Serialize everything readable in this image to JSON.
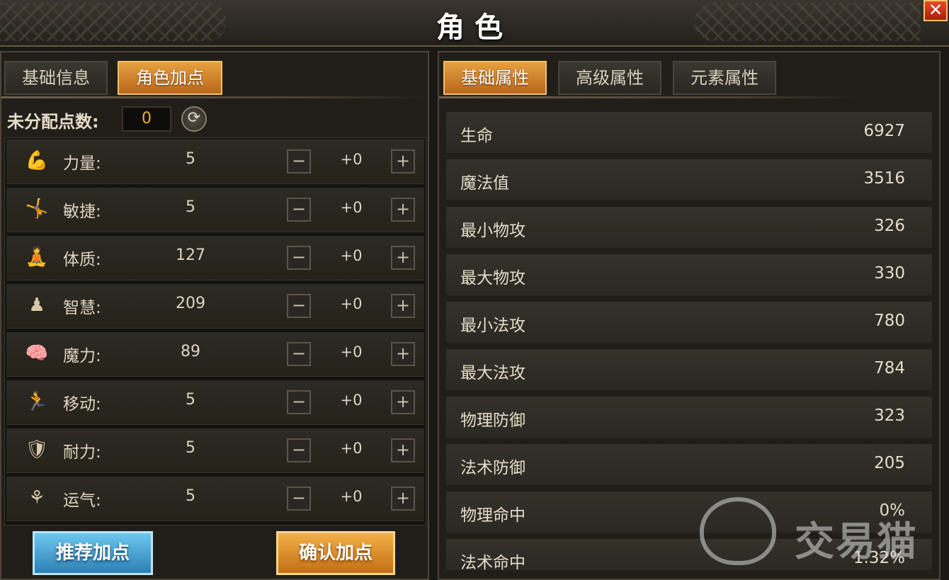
{
  "window": {
    "title": "角色",
    "close_label": "✕"
  },
  "left": {
    "tabs": [
      {
        "label": "基础信息",
        "active": false
      },
      {
        "label": "角色加点",
        "active": true
      }
    ],
    "unallocated": {
      "label": "未分配点数:",
      "value": "0"
    },
    "stats": [
      {
        "icon": "strength-arm-icon",
        "name": "力量:",
        "value": "5",
        "added": "+0"
      },
      {
        "icon": "agility-figure-icon",
        "name": "敏捷:",
        "value": "5",
        "added": "+0"
      },
      {
        "icon": "constitution-body-icon",
        "name": "体质:",
        "value": "127",
        "added": "+0"
      },
      {
        "icon": "wisdom-figure-icon",
        "name": "智慧:",
        "value": "209",
        "added": "+0"
      },
      {
        "icon": "magic-brain-icon",
        "name": "魔力:",
        "value": "89",
        "added": "+0"
      },
      {
        "icon": "movement-runner-icon",
        "name": "移动:",
        "value": "5",
        "added": "+0"
      },
      {
        "icon": "endurance-shield-icon",
        "name": "耐力:",
        "value": "5",
        "added": "+0"
      },
      {
        "icon": "luck-flower-icon",
        "name": "运气:",
        "value": "5",
        "added": "+0"
      }
    ],
    "minus_label": "−",
    "plus_label": "+",
    "recommend_button": "推荐加点",
    "confirm_button": "确认加点"
  },
  "right": {
    "tabs": [
      {
        "label": "基础属性",
        "active": true
      },
      {
        "label": "高级属性",
        "active": false
      },
      {
        "label": "元素属性",
        "active": false
      }
    ],
    "attributes": [
      {
        "name": "生命",
        "value": "6927"
      },
      {
        "name": "魔法值",
        "value": "3516"
      },
      {
        "name": "最小物攻",
        "value": "326"
      },
      {
        "name": "最大物攻",
        "value": "330"
      },
      {
        "name": "最小法攻",
        "value": "780"
      },
      {
        "name": "最大法攻",
        "value": "784"
      },
      {
        "name": "物理防御",
        "value": "323"
      },
      {
        "name": "法术防御",
        "value": "205"
      },
      {
        "name": "物理命中",
        "value": "0%"
      },
      {
        "name": "法术命中",
        "value": "1.32%"
      }
    ]
  },
  "watermark": {
    "text": "交易猫"
  },
  "colors": {
    "accent_orange": "#d88a2e",
    "accent_blue": "#3f9fd2",
    "panel": "#211e1a"
  }
}
